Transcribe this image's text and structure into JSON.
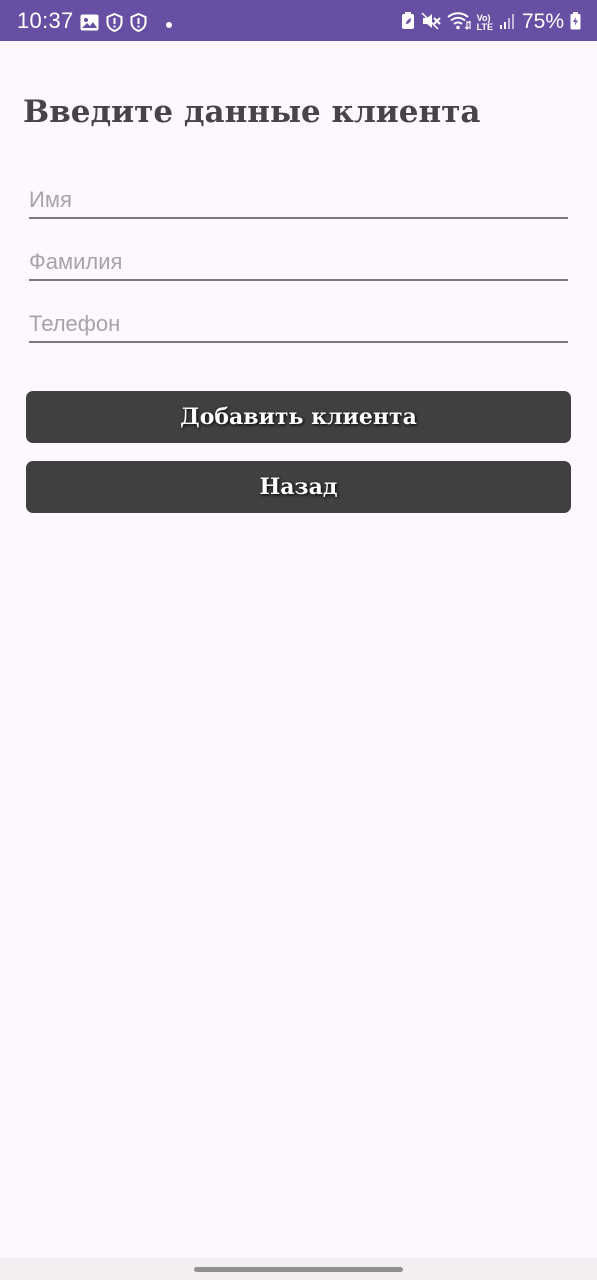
{
  "status_bar": {
    "time": "10:37",
    "battery": "75%",
    "left_icons": [
      "image-icon",
      "shield-alert-icon",
      "shield-alert-icon",
      "notification-dot-icon"
    ],
    "right_icons": [
      "battery-saver-icon",
      "mute-icon",
      "wifi-icon",
      "volte-icon",
      "signal-icon",
      "battery-icon"
    ],
    "volte_label_top": "Vo)",
    "volte_label_bottom": "LTE",
    "background": "#6750a4"
  },
  "form": {
    "title": "Введите данные клиента",
    "first_name": {
      "placeholder": "Имя",
      "value": ""
    },
    "last_name": {
      "placeholder": "Фамилия",
      "value": ""
    },
    "phone": {
      "placeholder": "Телефон",
      "value": ""
    }
  },
  "buttons": {
    "add_client": "Добавить клиента",
    "back": "Назад",
    "color": "#404040"
  }
}
